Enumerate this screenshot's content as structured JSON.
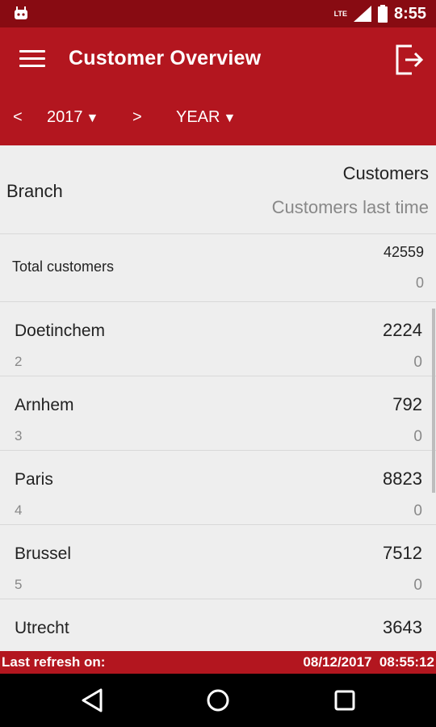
{
  "status_bar": {
    "network": "LTE",
    "time": "8:55"
  },
  "app_bar": {
    "title": "Customer Overview",
    "prev_label": "<",
    "year": "2017",
    "next_label": ">",
    "period": "YEAR",
    "dropdown_glyph": "▼"
  },
  "table_header": {
    "branch": "Branch",
    "customers": "Customers",
    "customers_last_time": "Customers last time"
  },
  "total": {
    "label": "Total customers",
    "value": "42559",
    "last_time": "0"
  },
  "rows": [
    {
      "name": "Doetinchem",
      "rank": "2",
      "value": "2224",
      "last_time": "0"
    },
    {
      "name": "Arnhem",
      "rank": "3",
      "value": "792",
      "last_time": "0"
    },
    {
      "name": "Paris",
      "rank": "4",
      "value": "8823",
      "last_time": "0"
    },
    {
      "name": "Brussel",
      "rank": "5",
      "value": "7512",
      "last_time": "0"
    },
    {
      "name": "Utrecht",
      "rank": "",
      "value": "3643",
      "last_time": ""
    }
  ],
  "footer": {
    "label": "Last refresh on:",
    "datetime": "08/12/2017  08:55:12"
  },
  "colors": {
    "primary": "#b3161f",
    "primary_dark": "#880b12",
    "background": "#eeeeee"
  },
  "icons": {
    "menu": "menu-icon",
    "logout": "logout-icon",
    "back": "back-icon",
    "home": "home-icon",
    "recents": "recents-icon"
  }
}
